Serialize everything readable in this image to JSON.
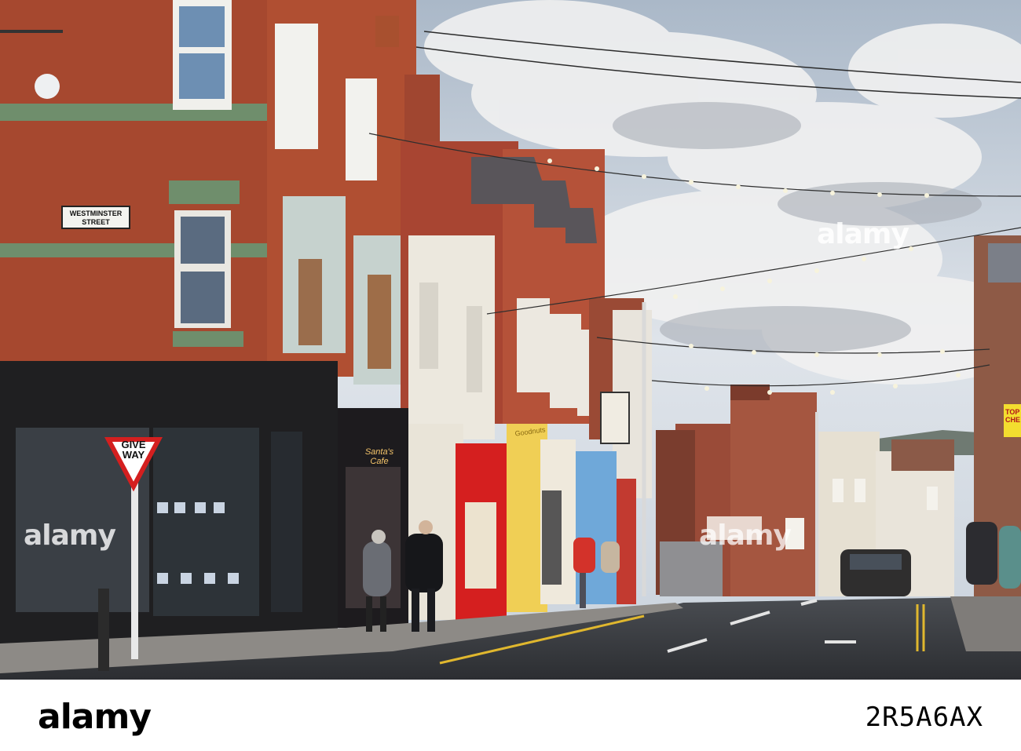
{
  "image": {
    "scene": "town high street with brick terraced shops and festoon lights",
    "sky_color": "#c9d6e4",
    "cloud_color": "#f2f2f2",
    "brick_color": "#a84a34",
    "road_color": "#3a3c40"
  },
  "signs": {
    "street_name_line1": "WESTMINSTER",
    "street_name_line2": "STREET",
    "give_way_line1": "GIVE",
    "give_way_line2": "WAY",
    "shop_1": "Santa's Cafe",
    "shop_2": "Goodnuts",
    "shop_3": "TOP CHE"
  },
  "watermark": {
    "logo": "alamy",
    "image_id": "2R5A6AX",
    "overlay": "alamy"
  }
}
